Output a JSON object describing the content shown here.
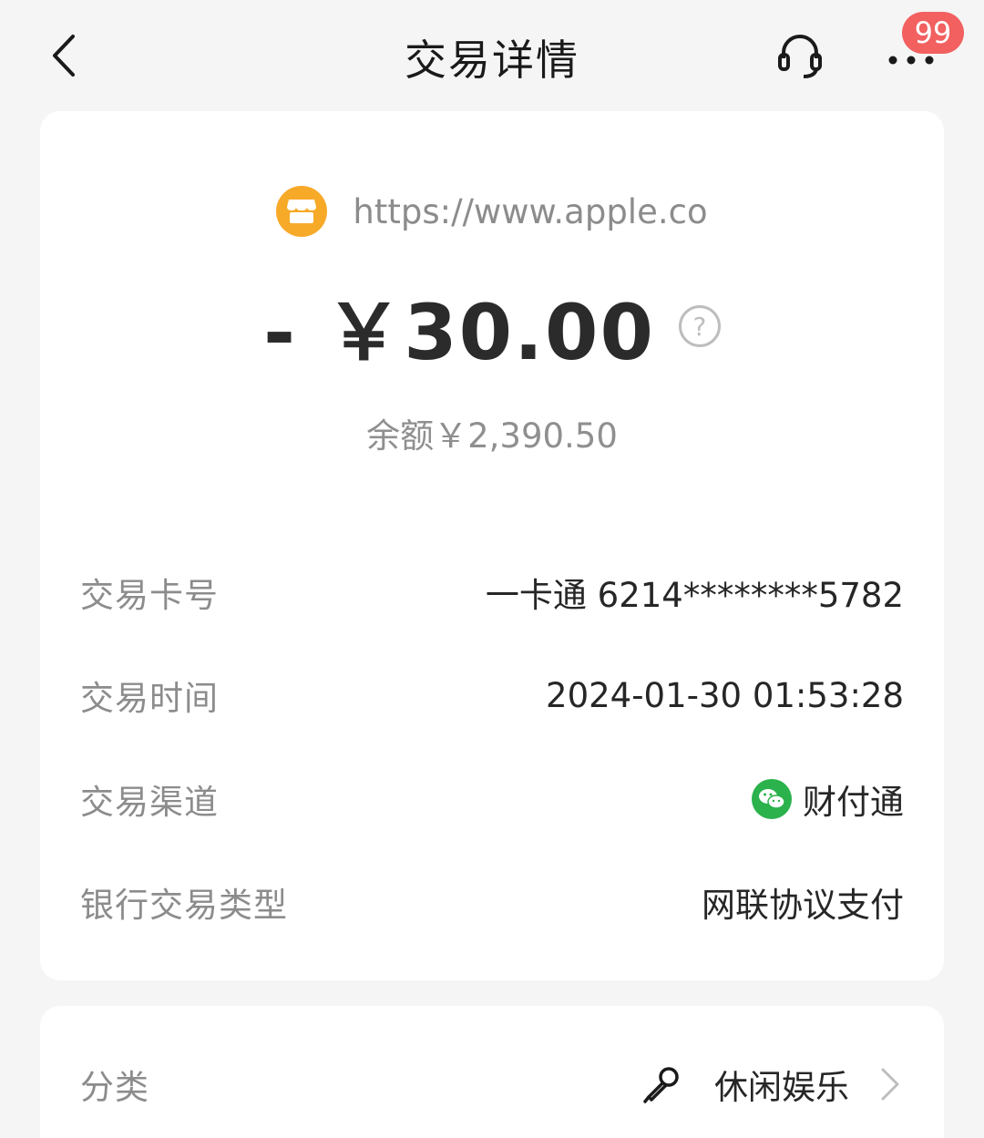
{
  "header": {
    "title": "交易详情",
    "badge_count": "99"
  },
  "merchant": {
    "name": "https://www.apple.co",
    "logo_icon": "store-icon",
    "logo_color": "#f7a928"
  },
  "amount": {
    "value": "- ￥30.00",
    "balance": "余额￥2,390.50"
  },
  "details": [
    {
      "label": "交易卡号",
      "value": "一卡通 6214********5782"
    },
    {
      "label": "交易时间",
      "value": "2024-01-30 01:53:28"
    },
    {
      "label": "交易渠道",
      "value": "财付通",
      "icon": "wechat-icon"
    },
    {
      "label": "银行交易类型",
      "value": "网联协议支付"
    }
  ],
  "category": {
    "label": "分类",
    "value": "休闲娱乐",
    "icon": "microphone-icon"
  },
  "colors": {
    "accent_badge": "#f26060",
    "wechat_green": "#2bb24c"
  }
}
